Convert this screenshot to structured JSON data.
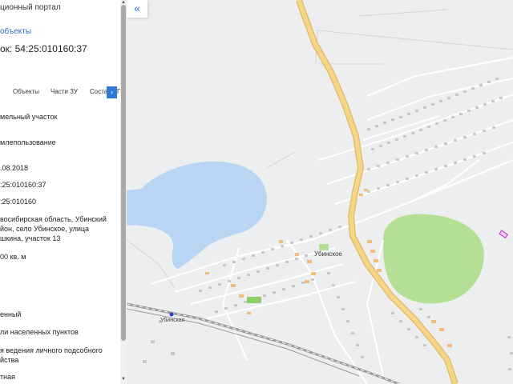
{
  "sidebar": {
    "portal_title": "ционный портал",
    "back_link": "объекты",
    "cadastral_title": "ок: 54:25:010160:37",
    "tabs": [
      "Объекты",
      "Части ЗУ",
      "Соста"
    ],
    "tab_next": "›",
    "tab_clipped": "Г",
    "fields": [
      "мельный участок",
      "млепользование",
      ".08.2018",
      ":25:010160:37",
      ":25:010160",
      "восибирская область, Убинский",
      "йон, село Убинское, улица",
      "шкина, участок 13",
      "00 кв. м",
      "енный",
      "ли населенных пунктов",
      "я ведения личного подсобного",
      "йства",
      "тная"
    ]
  },
  "map": {
    "collapse_icon": "«",
    "village_label": "Убинское",
    "station_label": "Убинская",
    "colors": {
      "background": "#eceeef",
      "road": "#f4d58a",
      "road_edge": "#e3b95d",
      "water": "#b8d6f4",
      "forest": "#b5df95",
      "buildings": "#c9c9c9",
      "orange_buildings": "#f2bf7a",
      "highlight": "#c43fd0",
      "accent": "#2d7ad6"
    }
  }
}
